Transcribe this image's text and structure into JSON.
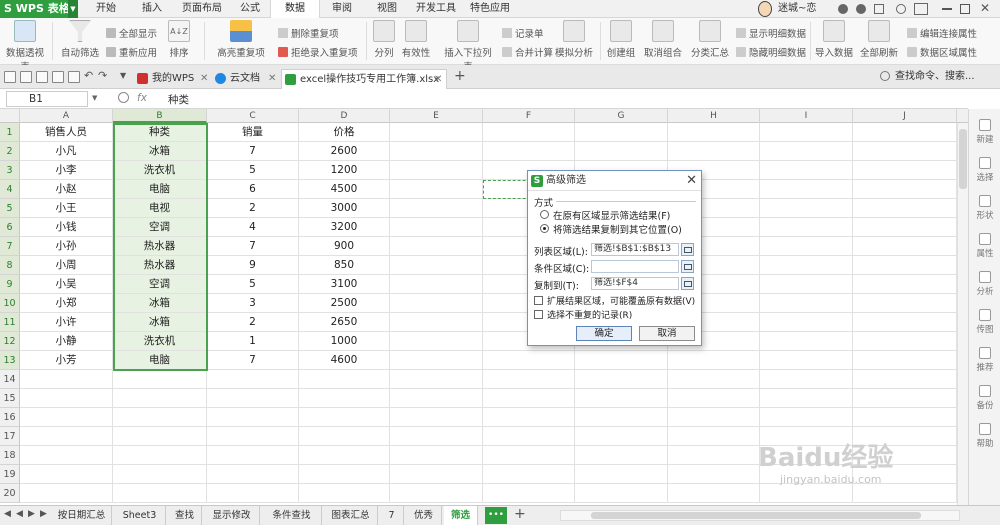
{
  "app": {
    "logo": "S WPS 表格"
  },
  "menu": [
    "开始",
    "插入",
    "页面布局",
    "公式",
    "数据",
    "审阅",
    "视图",
    "开发工具",
    "特色应用"
  ],
  "menu_active_index": 4,
  "user": {
    "name": "迷城~恋"
  },
  "ribbon": {
    "big": [
      "数据透视表",
      "自动筛选",
      "排序",
      "高亮重复项",
      "拒绝录入重复项",
      "分列",
      "有效性",
      "插入下拉列表",
      "合并计算",
      "模拟分析",
      "创建组",
      "取消组合",
      "分类汇总",
      "隐藏明细数据",
      "导入数据",
      "全部刷新",
      "数据区域属性"
    ],
    "small": [
      "全部显示",
      "重新应用",
      "删除重复项",
      "记录单",
      "显示明细数据",
      "编辑连接属性"
    ],
    "sort_glyph": "A↓Z"
  },
  "tabs": {
    "items": [
      "我的WPS",
      "云文档",
      "excel操作技巧专用工作簿.xlsx *"
    ],
    "add": "+",
    "search": "查找命令、搜索..."
  },
  "formula": {
    "cell": "B1",
    "fx": "fx",
    "value": "种类"
  },
  "columns": [
    "A",
    "B",
    "C",
    "D",
    "E",
    "F",
    "G",
    "H",
    "I",
    "J"
  ],
  "rows": [
    "1",
    "2",
    "3",
    "4",
    "5",
    "6",
    "7",
    "8",
    "9",
    "10",
    "11",
    "12",
    "13",
    "14",
    "15",
    "16",
    "17",
    "18",
    "19",
    "20"
  ],
  "table": {
    "headers": [
      "销售人员",
      "种类",
      "销量",
      "价格"
    ],
    "data": [
      [
        "小凡",
        "冰箱",
        "7",
        "2600"
      ],
      [
        "小李",
        "洗衣机",
        "5",
        "1200"
      ],
      [
        "小赵",
        "电脑",
        "6",
        "4500"
      ],
      [
        "小王",
        "电视",
        "2",
        "3000"
      ],
      [
        "小钱",
        "空调",
        "4",
        "3200"
      ],
      [
        "小孙",
        "热水器",
        "7",
        "900"
      ],
      [
        "小周",
        "热水器",
        "9",
        "850"
      ],
      [
        "小吴",
        "空调",
        "5",
        "3100"
      ],
      [
        "小郑",
        "冰箱",
        "3",
        "2500"
      ],
      [
        "小许",
        "冰箱",
        "2",
        "2650"
      ],
      [
        "小静",
        "洗衣机",
        "1",
        "1000"
      ],
      [
        "小芳",
        "电脑",
        "7",
        "4600"
      ]
    ]
  },
  "right_panel": [
    "新建",
    "选择",
    "形状",
    "属性",
    "分析",
    "传图",
    "推荐",
    "备份",
    "帮助"
  ],
  "sheets": [
    "按日期汇总",
    "Sheet3",
    "查找",
    "显示修改",
    "条件查找",
    "图表汇总",
    "7",
    "优秀",
    "筛选"
  ],
  "sheets_active_index": 8,
  "sheets_more": "•••",
  "sheets_add": "+",
  "dialog": {
    "title": "高级筛选",
    "close": "✕",
    "mode_label": "方式",
    "option1": "在原有区域显示筛选结果(F)",
    "option2": "将筛选结果复制到其它位置(O)",
    "list_label": "列表区域(L):",
    "list_value": "筛选!$B$1:$B$13",
    "criteria_label": "条件区域(C):",
    "criteria_value": "",
    "copyto_label": "复制到(T):",
    "copyto_value": "筛选!$F$4",
    "check1": "扩展结果区域，可能覆盖原有数据(V)",
    "check2": "选择不重复的记录(R)",
    "ok": "确定",
    "cancel": "取消"
  },
  "watermark": {
    "main": "Baidu经验",
    "sub": "jingyan.baidu.com"
  }
}
